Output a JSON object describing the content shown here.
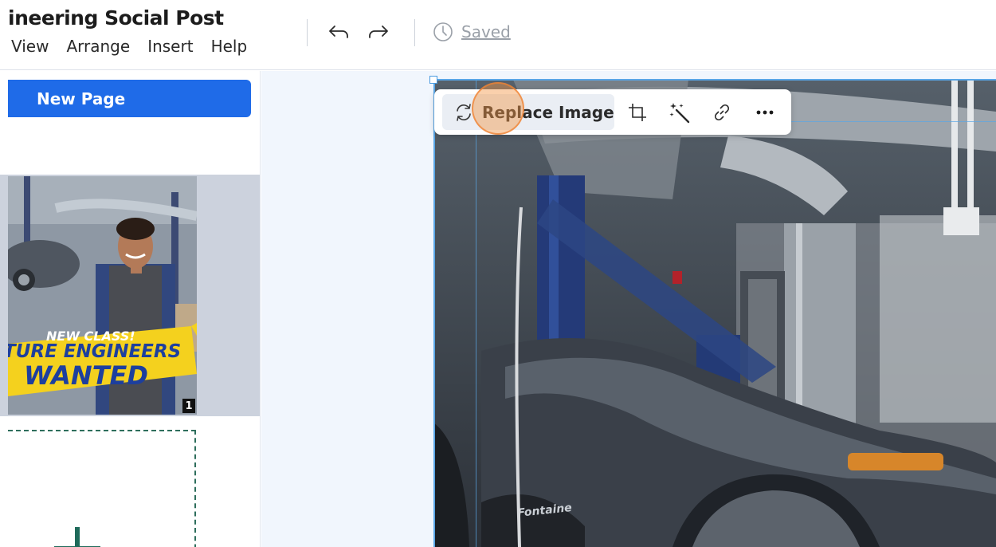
{
  "header": {
    "title": "ineering Social Post",
    "menu": [
      "View",
      "Arrange",
      "Insert",
      "Help"
    ],
    "saved_label": "Saved"
  },
  "left_panel": {
    "new_page_label": "New Page",
    "thumbnail": {
      "line1": "NEW CLASS!",
      "line2": "TURE ENGINEERS",
      "line3": "WANTED",
      "page_number": "1"
    }
  },
  "toolbar": {
    "replace_label": "Replace Image",
    "icons": [
      "replace-icon",
      "crop-icon",
      "magic-wand-icon",
      "link-icon",
      "more-icon"
    ]
  },
  "photo": {
    "cap_text": "Fontaine"
  },
  "colors": {
    "accent": "#1f6be8",
    "selection": "#5aa6e6",
    "banner_yellow": "#f4d11e",
    "banner_blue": "#1d3f9e"
  }
}
